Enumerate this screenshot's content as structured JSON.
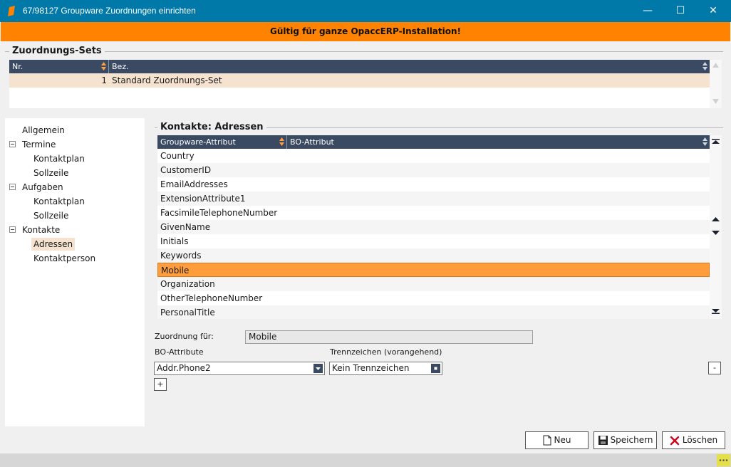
{
  "window": {
    "title": "67/98127 Groupware Zuordnungen einrichten",
    "minimize_glyph": "—",
    "maximize_glyph": "☐",
    "close_glyph": "✕"
  },
  "banner": {
    "text": "Gültig für ganze OpaccERP-Installation!"
  },
  "sets": {
    "title": "Zuordnungs-Sets",
    "columns": [
      "Nr.",
      "Bez."
    ],
    "rows": [
      {
        "nr": "1",
        "bez": "Standard Zuordnungs-Set"
      }
    ]
  },
  "tree": {
    "items": [
      {
        "label": "Allgemein"
      },
      {
        "label": "Termine"
      },
      {
        "label": "Kontaktplan"
      },
      {
        "label": "Sollzeile"
      },
      {
        "label": "Aufgaben"
      },
      {
        "label": "Kontaktplan"
      },
      {
        "label": "Sollzeile"
      },
      {
        "label": "Kontakte"
      },
      {
        "label": "Adressen"
      },
      {
        "label": "Kontaktperson"
      }
    ]
  },
  "mapping": {
    "title": "Kontakte: Adressen",
    "columns": [
      "Groupware-Attribut",
      "BO-Attribut"
    ],
    "rows": [
      "Country",
      "CustomerID",
      "EmailAddresses",
      "ExtensionAttribute1",
      "FacsimileTelephoneNumber",
      "GivenName",
      "Initials",
      "Keywords",
      "Mobile",
      "Organization",
      "OtherTelephoneNumber",
      "PersonalTitle"
    ]
  },
  "form": {
    "zuordnung_label": "Zuordnung für:",
    "zuordnung_value": "Mobile",
    "bo_label": "BO-Attribute",
    "bo_value": "Addr.Phone2",
    "trenn_label": "Trennzeichen (vorangehend)",
    "trenn_value": "Kein Trennzeichen",
    "add_label": "+",
    "remove_label": "-"
  },
  "buttons": {
    "neu": "Neu",
    "speichern": "Speichern",
    "loeschen": "Löschen"
  },
  "colors": {
    "titlebar": "#0078a8",
    "banner": "#ff8200",
    "grid_header": "#3a4a63",
    "selected_row": "#ff9d3c",
    "alt_row": "#f5f5f5",
    "highlight": "#f5e3d0"
  }
}
